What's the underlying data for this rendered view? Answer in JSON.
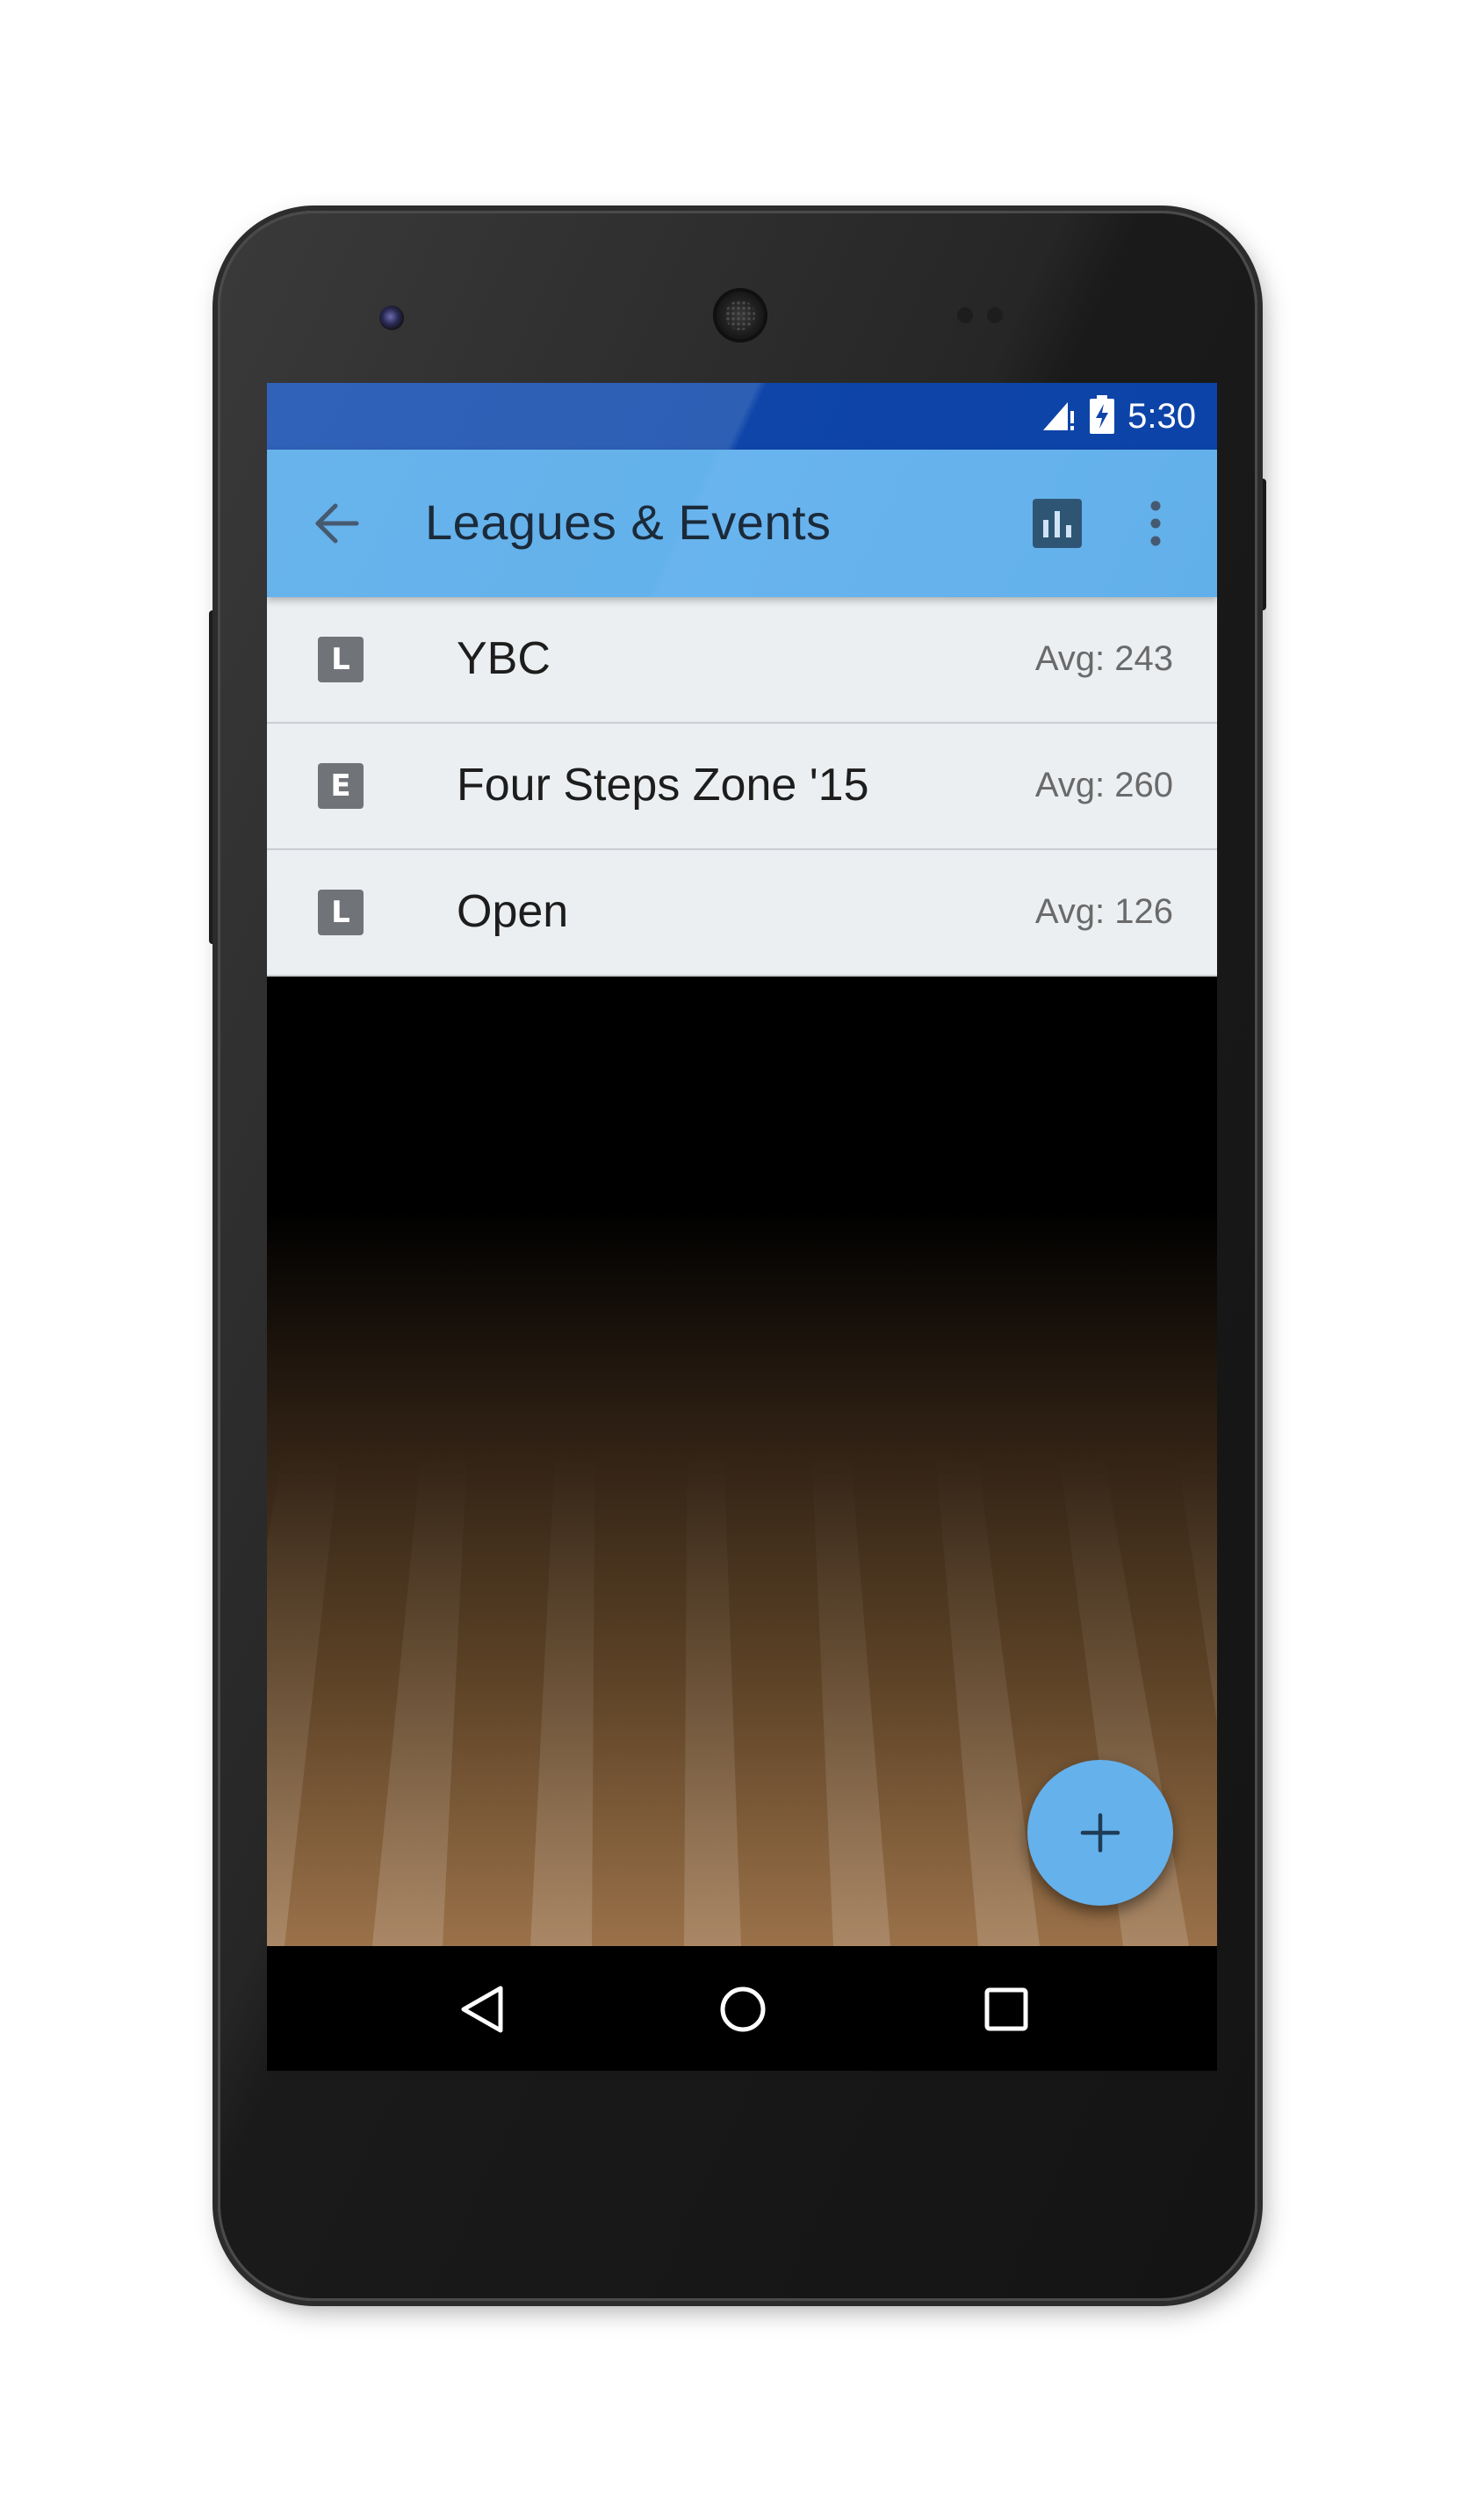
{
  "status_bar": {
    "time": "5:30",
    "icons": [
      "signal-icon",
      "battery-icon"
    ]
  },
  "app_bar": {
    "title": "Leagues & Events",
    "actions": [
      "back-arrow-icon",
      "stats-icon",
      "more-vert-icon"
    ]
  },
  "list": {
    "items": [
      {
        "type": "L",
        "name": "YBC",
        "average": "Avg: 243"
      },
      {
        "type": "E",
        "name": "Four Steps Zone '15",
        "average": "Avg: 260"
      },
      {
        "type": "L",
        "name": "Open",
        "average": "Avg: 126"
      }
    ]
  },
  "fab": {
    "icon": "plus-icon"
  },
  "nav_bar": {
    "buttons": [
      "nav-back-icon",
      "nav-home-icon",
      "nav-recents-icon"
    ]
  },
  "colors": {
    "status_bar": "#2d5fb5",
    "app_bar": "#64b2eb",
    "fab": "#65b1ec",
    "list_background": "#eceff1",
    "badge": "#707377"
  }
}
